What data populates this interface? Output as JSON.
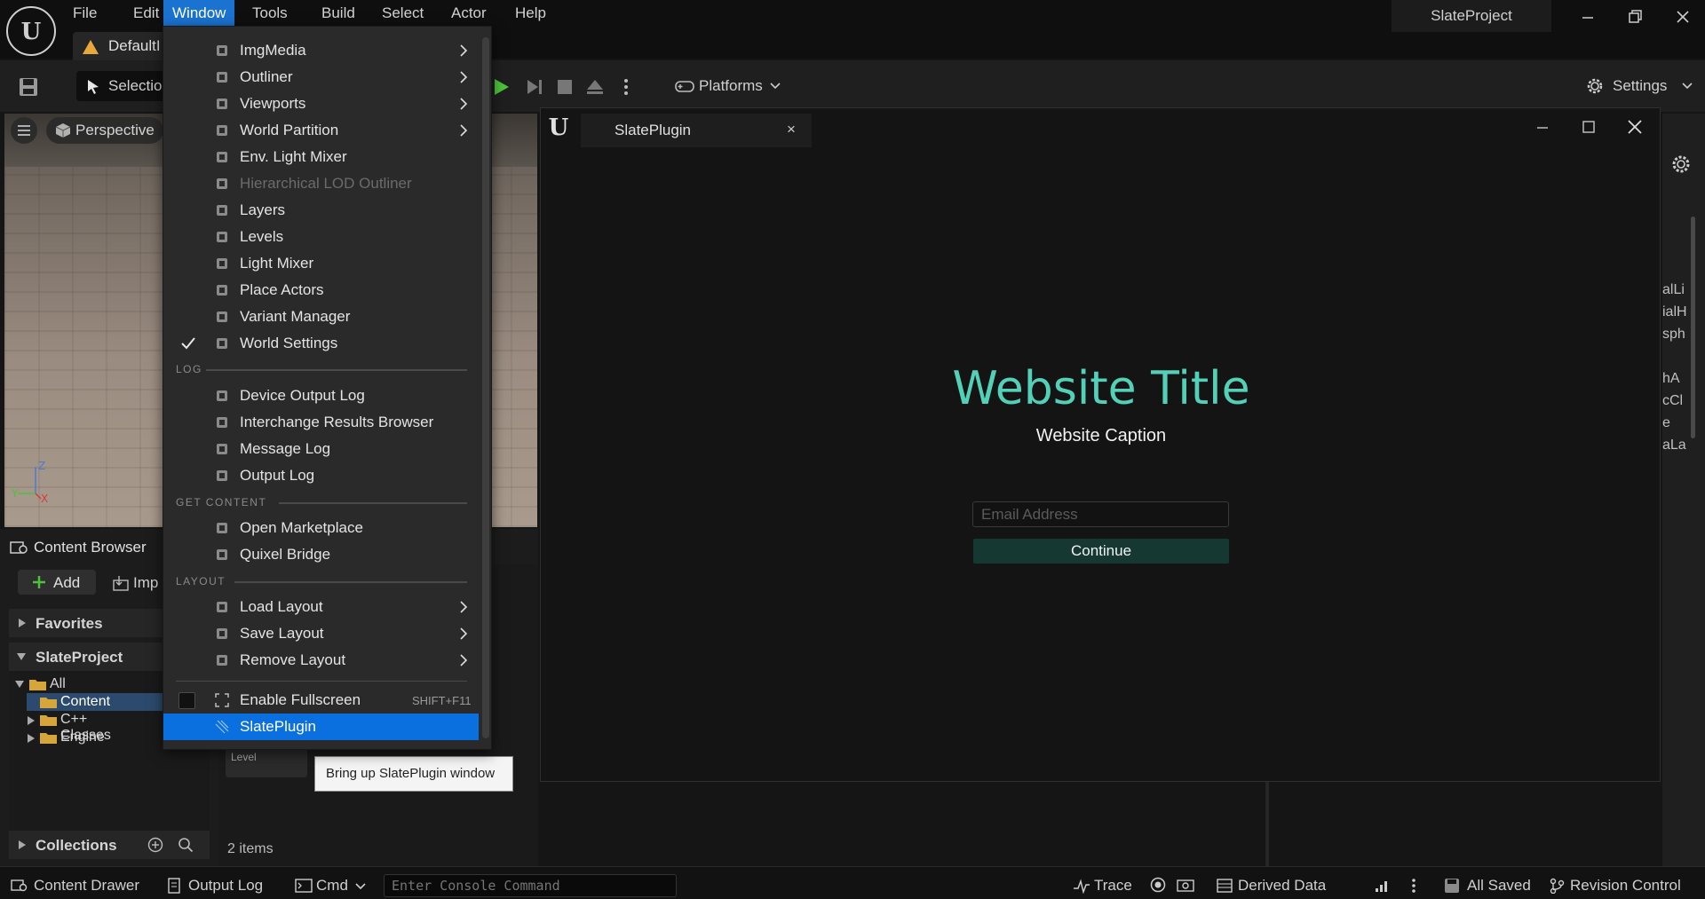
{
  "menubar": {
    "items": [
      "File",
      "Edit",
      "Window",
      "Tools",
      "Build",
      "Select",
      "Actor",
      "Help"
    ],
    "active": "Window"
  },
  "project_name": "SlateProject",
  "level_tab": {
    "label": "DefaultI"
  },
  "toolbar": {
    "selection_label": "Selectio",
    "platforms_label": "Platforms",
    "settings_label": "Settings"
  },
  "viewport": {
    "perspective_label": "Perspective"
  },
  "content_browser": {
    "tab_label": "Content Browser",
    "add_label": "Add",
    "import_label": "Imp",
    "favorites_label": "Favorites",
    "project_label": "SlateProject",
    "tree": [
      "All",
      "Content",
      "C++ Classes",
      "Engine"
    ],
    "collections_label": "Collections",
    "items_count": "2 items",
    "level_card_label": "Level",
    "tooltip": "Bring up SlatePlugin window"
  },
  "right_panel_fragments": [
    "alLi",
    "ialH",
    "sph",
    "hA",
    "cCl",
    "e",
    "aLa"
  ],
  "statusbar": {
    "content_drawer": "Content Drawer",
    "output_log": "Output Log",
    "cmd": "Cmd",
    "console_placeholder": "Enter Console Command",
    "trace": "Trace",
    "derived_data": "Derived Data",
    "all_saved": "All Saved",
    "revision_control": "Revision Control"
  },
  "window_menu": {
    "items_a": [
      {
        "label": "ImgMedia",
        "icon": "media-icon",
        "submenu": true
      },
      {
        "label": "Outliner",
        "icon": "outliner-icon",
        "submenu": true
      },
      {
        "label": "Viewports",
        "icon": "viewports-icon",
        "submenu": true
      },
      {
        "label": "World Partition",
        "icon": "world-partition-icon",
        "submenu": true
      },
      {
        "label": "Env. Light Mixer",
        "icon": "env-light-icon",
        "submenu": false
      },
      {
        "label": "Hierarchical LOD Outliner",
        "icon": "hlod-icon",
        "submenu": false,
        "disabled": true
      },
      {
        "label": "Layers",
        "icon": "layers-icon",
        "submenu": false
      },
      {
        "label": "Levels",
        "icon": "levels-icon",
        "submenu": false
      },
      {
        "label": "Light Mixer",
        "icon": "light-mixer-icon",
        "submenu": false
      },
      {
        "label": "Place Actors",
        "icon": "place-actors-icon",
        "submenu": false
      },
      {
        "label": "Variant Manager",
        "icon": "variant-manager-icon",
        "submenu": false
      },
      {
        "label": "World Settings",
        "icon": "world-settings-icon",
        "submenu": false,
        "checked": true
      }
    ],
    "section_log": "LOG",
    "items_log": [
      {
        "label": "Device Output Log",
        "icon": "log-icon"
      },
      {
        "label": "Interchange Results Browser",
        "icon": "interchange-icon"
      },
      {
        "label": "Message Log",
        "icon": "log-icon"
      },
      {
        "label": "Output Log",
        "icon": "log-icon"
      }
    ],
    "section_content": "GET CONTENT",
    "items_content": [
      {
        "label": "Open Marketplace",
        "icon": "marketplace-icon"
      },
      {
        "label": "Quixel Bridge",
        "icon": "bridge-icon"
      }
    ],
    "section_layout": "LAYOUT",
    "items_layout": [
      {
        "label": "Load Layout",
        "icon": "layout-icon",
        "submenu": true
      },
      {
        "label": "Save Layout",
        "icon": "layout-icon",
        "submenu": true
      },
      {
        "label": "Remove Layout",
        "icon": "layout-icon",
        "submenu": true
      }
    ],
    "fullscreen_label": "Enable Fullscreen",
    "fullscreen_shortcut": "SHIFT+F11",
    "slateplugin_label": "SlatePlugin"
  },
  "slate_window": {
    "tab_label": "SlatePlugin",
    "close_glyph": "×",
    "website_title": "Website Title",
    "website_caption": "Website Caption",
    "email_placeholder": "Email Address",
    "continue_label": "Continue",
    "title_color": "#52d1b8",
    "button_color": "#163832"
  },
  "colors": {
    "menu_highlight": "#0a70e0",
    "background": "#151515"
  }
}
